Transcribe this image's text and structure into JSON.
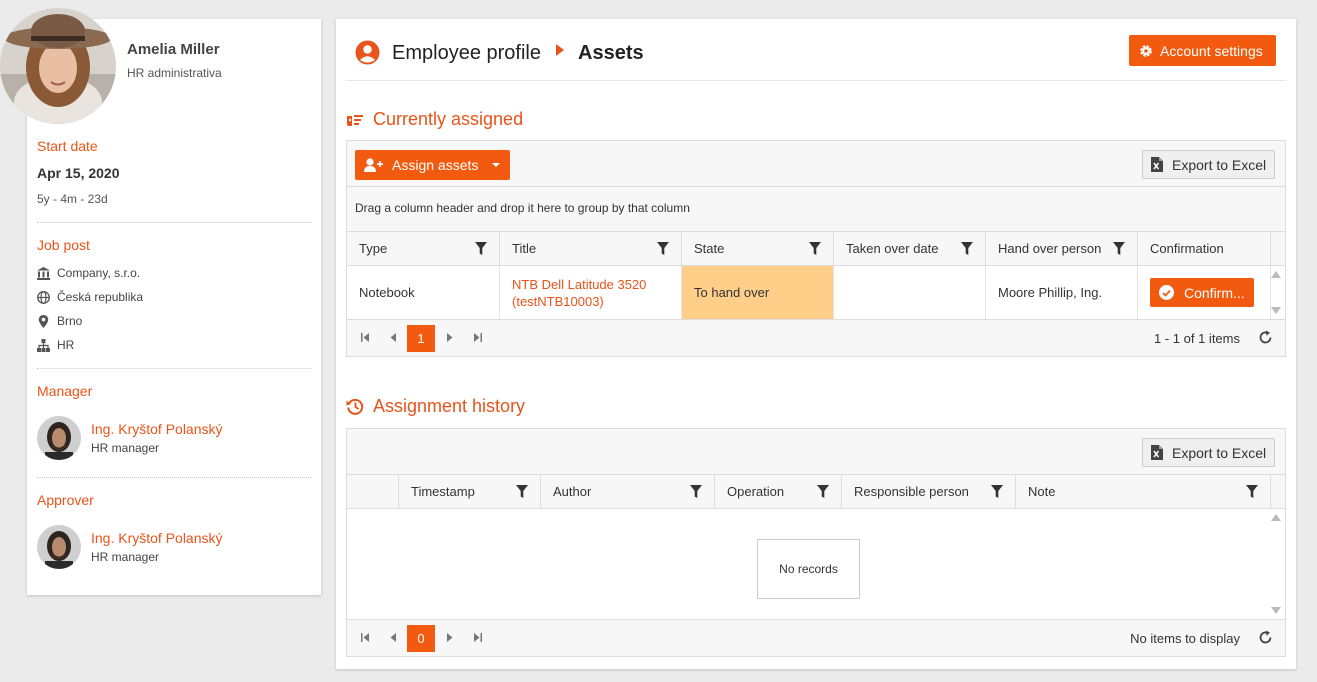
{
  "profile": {
    "name": "Amelia Miller",
    "role": "HR administrativa",
    "start_label": "Start date",
    "start_date": "Apr 15, 2020",
    "duration": "5y - 4m - 23d",
    "job_label": "Job post",
    "company": "Company, s.r.o.",
    "country": "Česká republika",
    "city": "Brno",
    "department": "HR",
    "manager_label": "Manager",
    "manager_name": "Ing. Kryštof Polanský",
    "manager_role": "HR manager",
    "approver_label": "Approver",
    "approver_name": "Ing. Kryštof Polanský",
    "approver_role": "HR manager"
  },
  "header": {
    "breadcrumb_1": "Employee profile",
    "breadcrumb_2": "Assets",
    "account_settings": "Account settings"
  },
  "assigned": {
    "title": "Currently assigned",
    "assign_label": "Assign assets",
    "export_label": "Export to Excel",
    "group_hint": "Drag a column header and drop it here to group by that column",
    "columns": [
      "Type",
      "Title",
      "State",
      "Taken over date",
      "Hand over person",
      "Confirmation"
    ],
    "row": {
      "type": "Notebook",
      "title_line1": "NTB Dell Latitude 3520",
      "title_line2": "(testNTB10003)",
      "state": "To hand over",
      "taken_over_date": "",
      "hand_over_person": "Moore Phillip, Ing.",
      "confirm_label": "Confirm..."
    },
    "page": "1",
    "page_info": "1 - 1 of 1 items"
  },
  "history": {
    "title": "Assignment history",
    "export_label": "Export to Excel",
    "columns": [
      "Timestamp",
      "Author",
      "Operation",
      "Responsible person",
      "Note"
    ],
    "empty_text": "No records",
    "page": "0",
    "page_info": "No items to display"
  },
  "colors": {
    "accent": "#f25b0f",
    "accent_text": "#e8541a",
    "state_highlight": "#ffcf8a"
  }
}
